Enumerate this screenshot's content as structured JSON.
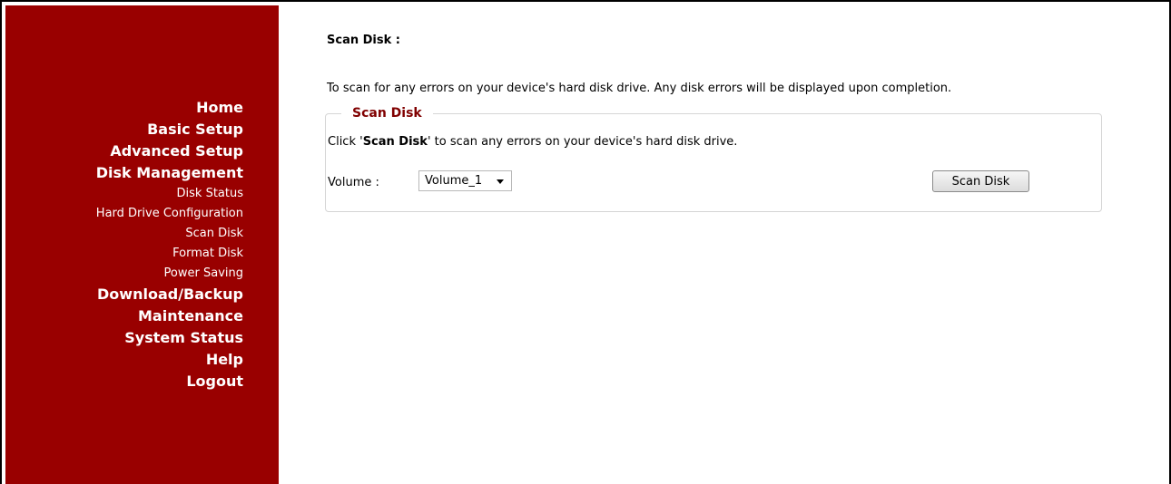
{
  "sidebar": {
    "items": [
      {
        "label": "Home",
        "level": "main"
      },
      {
        "label": "Basic Setup",
        "level": "main"
      },
      {
        "label": "Advanced Setup",
        "level": "main"
      },
      {
        "label": "Disk Management",
        "level": "main"
      },
      {
        "label": "Disk Status",
        "level": "sub"
      },
      {
        "label": "Hard Drive Configuration",
        "level": "sub"
      },
      {
        "label": "Scan Disk",
        "level": "sub"
      },
      {
        "label": "Format Disk",
        "level": "sub"
      },
      {
        "label": "Power Saving",
        "level": "sub"
      },
      {
        "label": "Download/Backup",
        "level": "main"
      },
      {
        "label": "Maintenance",
        "level": "main"
      },
      {
        "label": "System Status",
        "level": "main"
      },
      {
        "label": "Help",
        "level": "main"
      },
      {
        "label": "Logout",
        "level": "main"
      }
    ]
  },
  "main": {
    "title": "Scan Disk :",
    "description": "To scan for any errors on your device's hard disk drive. Any disk errors will be displayed upon completion.",
    "section": {
      "legend": "Scan Disk",
      "instruction_prefix": "Click '",
      "instruction_bold": "Scan Disk",
      "instruction_suffix": "' to scan any errors on your device's hard disk drive.",
      "volume_label": "Volume :",
      "volume_value": "Volume_1",
      "button_label": "Scan Disk"
    }
  },
  "colors": {
    "sidebar_bg": "#990000",
    "legend_text": "#800000"
  }
}
